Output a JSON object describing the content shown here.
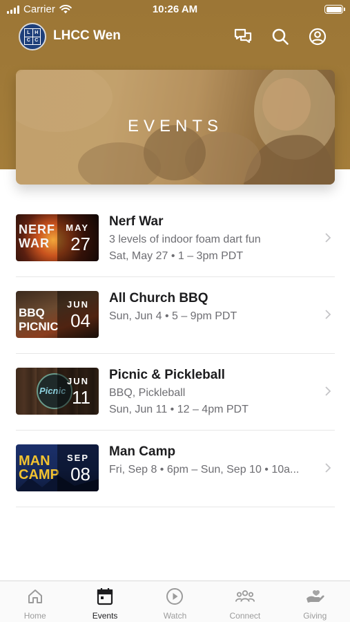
{
  "status_bar": {
    "carrier": "Carrier",
    "time": "10:26 AM"
  },
  "nav": {
    "app_title": "LHCC Wen",
    "logo_letters": [
      "L",
      "H",
      "C",
      "C"
    ],
    "icons": [
      "chat-icon",
      "search-icon",
      "profile-icon"
    ]
  },
  "hero": {
    "title": "EVENTS"
  },
  "events": [
    {
      "title": "Nerf War",
      "description": "3 levels of indoor foam dart fun",
      "datetime": "Sat, May 27 • 1 – 3pm PDT",
      "month": "MAY",
      "day": "27",
      "thumb_text": "NERF WAR"
    },
    {
      "title": "All Church BBQ",
      "description": "",
      "datetime": "Sun, Jun 4 • 5 – 9pm PDT",
      "month": "JUN",
      "day": "04",
      "thumb_text": "BBQ PICNIC"
    },
    {
      "title": "Picnic & Pickleball",
      "description": "BBQ, Pickleball",
      "datetime": "Sun, Jun 11 • 12 – 4pm PDT",
      "month": "JUN",
      "day": "11",
      "thumb_text": "Picnic"
    },
    {
      "title": "Man Camp",
      "description": "",
      "datetime": "Fri, Sep 8 • 6pm – Sun, Sep 10 • 10a...",
      "month": "SEP",
      "day": "08",
      "thumb_text": "MAN CAMP"
    }
  ],
  "tabs": [
    {
      "label": "Home",
      "icon": "home-icon",
      "active": false
    },
    {
      "label": "Events",
      "icon": "calendar-icon",
      "active": true
    },
    {
      "label": "Watch",
      "icon": "play-icon",
      "active": false
    },
    {
      "label": "Connect",
      "icon": "people-icon",
      "active": false
    },
    {
      "label": "Giving",
      "icon": "giving-hand-icon",
      "active": false
    }
  ],
  "colors": {
    "header": "#a07a38",
    "accent_logo": "#1e3f7a",
    "tab_inactive": "#9b9b9b",
    "tab_active": "#1c1c1e"
  }
}
